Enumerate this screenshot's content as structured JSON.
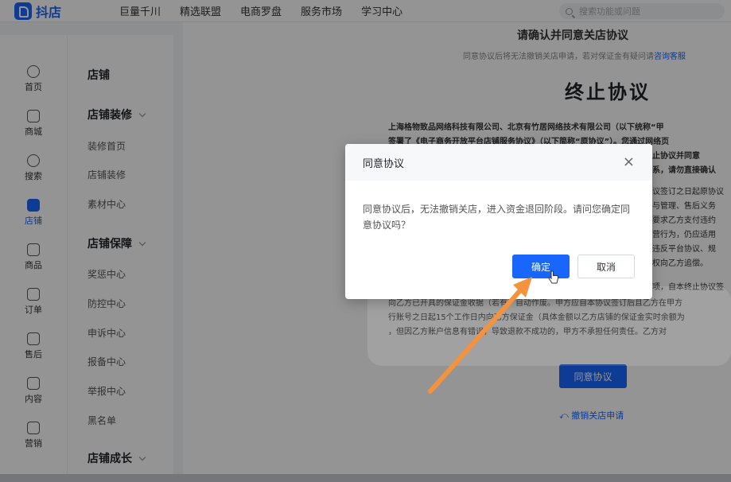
{
  "brand": {
    "name": "抖店"
  },
  "topnav": [
    "巨量千川",
    "精选联盟",
    "电商罗盘",
    "服务市场",
    "学习中心"
  ],
  "search": {
    "placeholder": "搜索功能或问题"
  },
  "rail": [
    {
      "label": "首页",
      "icon": "home-icon"
    },
    {
      "label": "商城",
      "icon": "store-icon"
    },
    {
      "label": "搜索",
      "icon": "search-icon"
    },
    {
      "label": "店铺",
      "icon": "shop-icon",
      "active": true
    },
    {
      "label": "商品",
      "icon": "product-icon"
    },
    {
      "label": "订单",
      "icon": "order-icon"
    },
    {
      "label": "售后",
      "icon": "after-sales-icon"
    },
    {
      "label": "内容",
      "icon": "content-icon"
    },
    {
      "label": "营销",
      "icon": "megaphone-icon"
    }
  ],
  "submenu": {
    "title": "店铺",
    "group1": {
      "title": "店铺装修",
      "items": [
        "装修首页",
        "店铺装修",
        "素材中心"
      ]
    },
    "group2": {
      "title": "店铺保障",
      "items": [
        "奖惩中心",
        "防控中心",
        "申诉中心",
        "报备中心",
        "举报中心",
        "黑名单"
      ]
    },
    "group3": {
      "title": "店铺成长"
    }
  },
  "main": {
    "heading": "请确认并同意关店协议",
    "subnote": "同意协议后将无法撤销关店申请，若对保证金有疑问请",
    "subnote_link": "咨询客服",
    "doc_title": "终止协议",
    "line1": "上海格物致品网络科技有限公司、北京有竹居网络技术有限公司（以下统称“甲",
    "line2": "签署了《电子商务开放平台店铺服务协议》（以下简称“原协议”）。您通过网络页",
    "frag1": "止协议并同意",
    "frag2": "系，请勿直接确认",
    "frag3": "议签订之日起原协议",
    "frag4": "与管理、售后义务",
    "frag5": "要求乙方支付违约",
    "frag6": "营行为，仍应适用",
    "frag7": "违反平台协议、规",
    "frag8": "权向乙方追偿。",
    "frag9": "项，自本终止协议签",
    "line3": "向乙方已开具的保证金收据（若有）自动作废。甲方应自本协议签订后且乙方在甲方",
    "line4": "行账号之日起15个工作日内向乙方保证金（具体金额以乙方店铺的保证金实时余额为",
    "line5": "，但因乙方账户信息有错误，导致退款不成功的，甲方不承担任何责任。乙方对",
    "agree_button": "同意协议",
    "revoke_link": "撤销关店申请"
  },
  "dialog": {
    "title": "同意协议",
    "message": "同意协议后，无法撤销关店，进入资金退回阶段。请问您确定同意协议吗？",
    "ok": "确定",
    "cancel": "取消"
  },
  "colors": {
    "accent": "#1966ff",
    "arrow": "#f5923e"
  }
}
